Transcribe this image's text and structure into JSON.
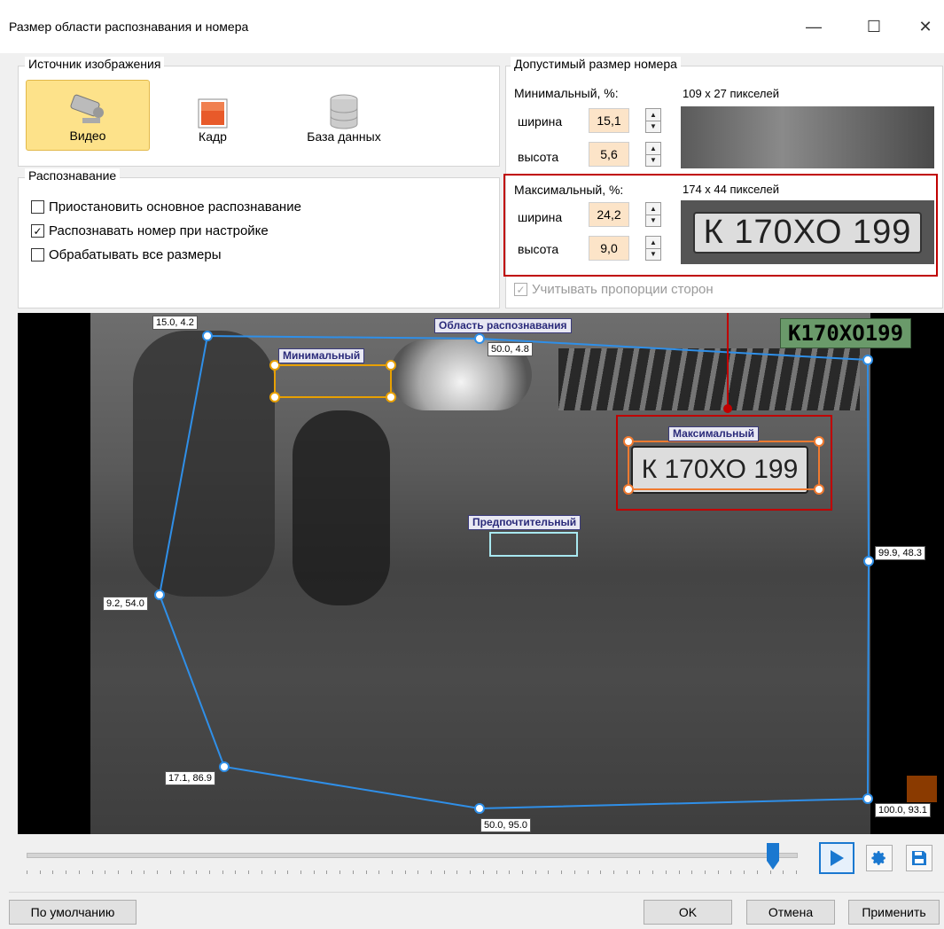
{
  "window": {
    "title": "Размер области распознавания и номера",
    "minimize": "—",
    "maximize": "☐",
    "close": "✕"
  },
  "source": {
    "group_label": "Источник изображения",
    "buttons": [
      {
        "label": "Видео"
      },
      {
        "label": "Кадр"
      },
      {
        "label": "База данных"
      }
    ]
  },
  "recognition": {
    "group_label": "Распознавание",
    "options": [
      {
        "label": "Приостановить основное распознавание",
        "checked": false
      },
      {
        "label": "Распознавать номер при настройке",
        "checked": true
      },
      {
        "label": "Обрабатывать все размеры",
        "checked": false
      }
    ]
  },
  "plate_size": {
    "group_label": "Допустимый размер номера",
    "min": {
      "title": "Минимальный, %:",
      "pixels": "109 x 27 пикселей",
      "width_label": "ширина",
      "width": "15,1",
      "height_label": "высота",
      "height": "5,6"
    },
    "max": {
      "title": "Максимальный, %:",
      "pixels": "174 x 44 пикселей",
      "width_label": "ширина",
      "width": "24,2",
      "height_label": "высота",
      "height": "9,0"
    },
    "keep_aspect": "Учитывать пропорции сторон",
    "plate_text": "К 170ХО 199"
  },
  "viewer": {
    "area_label": "Область распознавания",
    "min_label": "Минимальный",
    "max_label": "Максимальный",
    "pref_label": "Предпочтительный",
    "result": "К170ХО199",
    "points": [
      "15.0, 4.2",
      "50.0, 4.8",
      "99.9, 48.3",
      "9.2, 54.0",
      "17.1, 86.9",
      "50.0, 95.0",
      "100.0, 93.1"
    ]
  },
  "player": {
    "progress": 0.97
  },
  "colors": {
    "area": "#2f8fe8",
    "min": "#e8a000",
    "max": "#f07a30",
    "pref": "#a8e8f0",
    "highlight": "#c00000",
    "result_bg": "#6a9a6a"
  },
  "footer": {
    "default": "По умолчанию",
    "ok": "OK",
    "cancel": "Отмена",
    "apply": "Применить"
  }
}
